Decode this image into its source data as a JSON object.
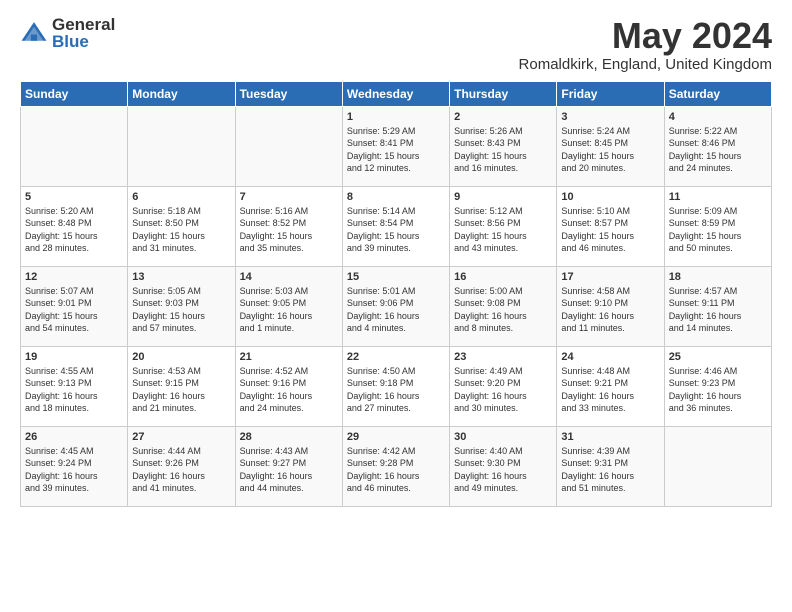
{
  "logo": {
    "general": "General",
    "blue": "Blue"
  },
  "header": {
    "month_year": "May 2024",
    "location": "Romaldkirk, England, United Kingdom"
  },
  "days_of_week": [
    "Sunday",
    "Monday",
    "Tuesday",
    "Wednesday",
    "Thursday",
    "Friday",
    "Saturday"
  ],
  "weeks": [
    [
      {
        "day": "",
        "info": ""
      },
      {
        "day": "",
        "info": ""
      },
      {
        "day": "",
        "info": ""
      },
      {
        "day": "1",
        "info": "Sunrise: 5:29 AM\nSunset: 8:41 PM\nDaylight: 15 hours\nand 12 minutes."
      },
      {
        "day": "2",
        "info": "Sunrise: 5:26 AM\nSunset: 8:43 PM\nDaylight: 15 hours\nand 16 minutes."
      },
      {
        "day": "3",
        "info": "Sunrise: 5:24 AM\nSunset: 8:45 PM\nDaylight: 15 hours\nand 20 minutes."
      },
      {
        "day": "4",
        "info": "Sunrise: 5:22 AM\nSunset: 8:46 PM\nDaylight: 15 hours\nand 24 minutes."
      }
    ],
    [
      {
        "day": "5",
        "info": "Sunrise: 5:20 AM\nSunset: 8:48 PM\nDaylight: 15 hours\nand 28 minutes."
      },
      {
        "day": "6",
        "info": "Sunrise: 5:18 AM\nSunset: 8:50 PM\nDaylight: 15 hours\nand 31 minutes."
      },
      {
        "day": "7",
        "info": "Sunrise: 5:16 AM\nSunset: 8:52 PM\nDaylight: 15 hours\nand 35 minutes."
      },
      {
        "day": "8",
        "info": "Sunrise: 5:14 AM\nSunset: 8:54 PM\nDaylight: 15 hours\nand 39 minutes."
      },
      {
        "day": "9",
        "info": "Sunrise: 5:12 AM\nSunset: 8:56 PM\nDaylight: 15 hours\nand 43 minutes."
      },
      {
        "day": "10",
        "info": "Sunrise: 5:10 AM\nSunset: 8:57 PM\nDaylight: 15 hours\nand 46 minutes."
      },
      {
        "day": "11",
        "info": "Sunrise: 5:09 AM\nSunset: 8:59 PM\nDaylight: 15 hours\nand 50 minutes."
      }
    ],
    [
      {
        "day": "12",
        "info": "Sunrise: 5:07 AM\nSunset: 9:01 PM\nDaylight: 15 hours\nand 54 minutes."
      },
      {
        "day": "13",
        "info": "Sunrise: 5:05 AM\nSunset: 9:03 PM\nDaylight: 15 hours\nand 57 minutes."
      },
      {
        "day": "14",
        "info": "Sunrise: 5:03 AM\nSunset: 9:05 PM\nDaylight: 16 hours\nand 1 minute."
      },
      {
        "day": "15",
        "info": "Sunrise: 5:01 AM\nSunset: 9:06 PM\nDaylight: 16 hours\nand 4 minutes."
      },
      {
        "day": "16",
        "info": "Sunrise: 5:00 AM\nSunset: 9:08 PM\nDaylight: 16 hours\nand 8 minutes."
      },
      {
        "day": "17",
        "info": "Sunrise: 4:58 AM\nSunset: 9:10 PM\nDaylight: 16 hours\nand 11 minutes."
      },
      {
        "day": "18",
        "info": "Sunrise: 4:57 AM\nSunset: 9:11 PM\nDaylight: 16 hours\nand 14 minutes."
      }
    ],
    [
      {
        "day": "19",
        "info": "Sunrise: 4:55 AM\nSunset: 9:13 PM\nDaylight: 16 hours\nand 18 minutes."
      },
      {
        "day": "20",
        "info": "Sunrise: 4:53 AM\nSunset: 9:15 PM\nDaylight: 16 hours\nand 21 minutes."
      },
      {
        "day": "21",
        "info": "Sunrise: 4:52 AM\nSunset: 9:16 PM\nDaylight: 16 hours\nand 24 minutes."
      },
      {
        "day": "22",
        "info": "Sunrise: 4:50 AM\nSunset: 9:18 PM\nDaylight: 16 hours\nand 27 minutes."
      },
      {
        "day": "23",
        "info": "Sunrise: 4:49 AM\nSunset: 9:20 PM\nDaylight: 16 hours\nand 30 minutes."
      },
      {
        "day": "24",
        "info": "Sunrise: 4:48 AM\nSunset: 9:21 PM\nDaylight: 16 hours\nand 33 minutes."
      },
      {
        "day": "25",
        "info": "Sunrise: 4:46 AM\nSunset: 9:23 PM\nDaylight: 16 hours\nand 36 minutes."
      }
    ],
    [
      {
        "day": "26",
        "info": "Sunrise: 4:45 AM\nSunset: 9:24 PM\nDaylight: 16 hours\nand 39 minutes."
      },
      {
        "day": "27",
        "info": "Sunrise: 4:44 AM\nSunset: 9:26 PM\nDaylight: 16 hours\nand 41 minutes."
      },
      {
        "day": "28",
        "info": "Sunrise: 4:43 AM\nSunset: 9:27 PM\nDaylight: 16 hours\nand 44 minutes."
      },
      {
        "day": "29",
        "info": "Sunrise: 4:42 AM\nSunset: 9:28 PM\nDaylight: 16 hours\nand 46 minutes."
      },
      {
        "day": "30",
        "info": "Sunrise: 4:40 AM\nSunset: 9:30 PM\nDaylight: 16 hours\nand 49 minutes."
      },
      {
        "day": "31",
        "info": "Sunrise: 4:39 AM\nSunset: 9:31 PM\nDaylight: 16 hours\nand 51 minutes."
      },
      {
        "day": "",
        "info": ""
      }
    ]
  ]
}
